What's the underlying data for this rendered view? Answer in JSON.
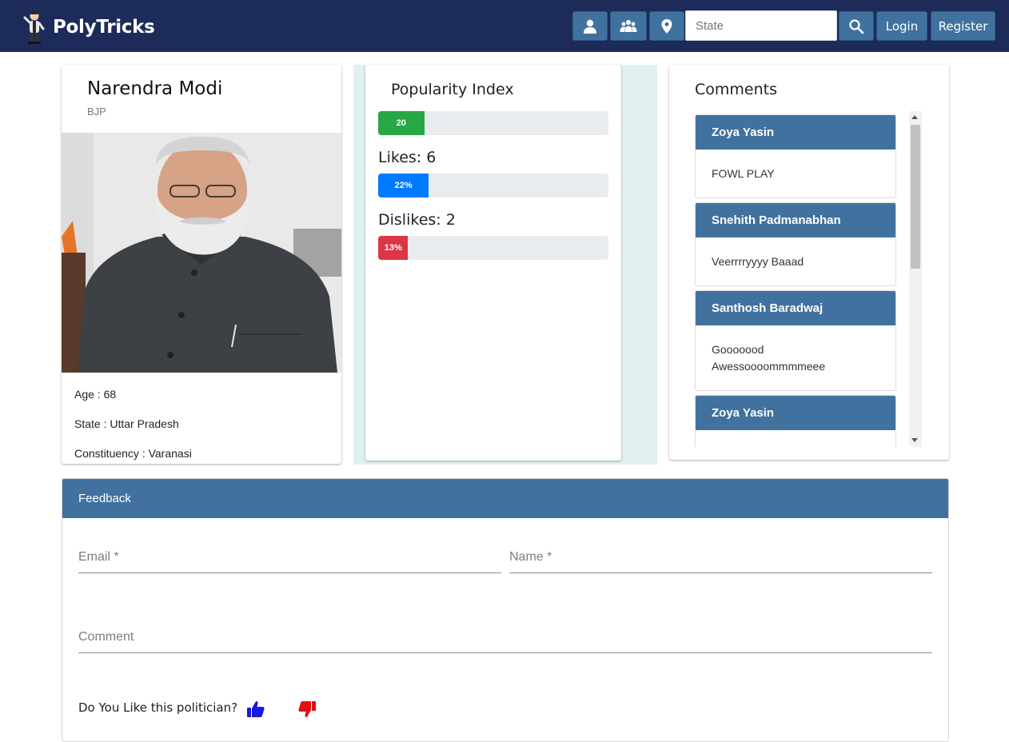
{
  "app": {
    "name": "PolyTricks"
  },
  "navbar": {
    "icons": [
      "person-icon",
      "group-icon",
      "location-pin-icon",
      "search-icon"
    ],
    "search": {
      "placeholder": "State",
      "value": ""
    },
    "login_label": "Login",
    "register_label": "Register"
  },
  "profile": {
    "name": "Narendra Modi",
    "party": "BJP",
    "age": "Age : 68",
    "state": "State : Uttar Pradesh",
    "constituency": "Constituency : Varanasi"
  },
  "popularity": {
    "title": "Popularity Index",
    "index_label": "20",
    "index_value": 20,
    "likes_label": "Likes: 6",
    "likes_percent_label": "22%",
    "likes_percent": 22,
    "dislikes_label": "Dislikes: 2",
    "dislikes_percent_label": "13%",
    "dislikes_percent": 13,
    "colors": {
      "index": "#28a745",
      "likes": "#007bff",
      "dislikes": "#dc3545"
    }
  },
  "comments": {
    "title": "Comments",
    "items": [
      {
        "author": "Zoya Yasin",
        "text": "FOWL PLAY"
      },
      {
        "author": "Snehith Padmanabhan",
        "text": "Veerrrryyyy Baaad"
      },
      {
        "author": "Santhosh Baradwaj",
        "text": "Gooooood Awessoooommmmeee"
      },
      {
        "author": "Zoya Yasin",
        "text": ""
      }
    ]
  },
  "feedback": {
    "title": "Feedback",
    "email_placeholder": "Email *",
    "name_placeholder": "Name *",
    "comment_placeholder": "Comment",
    "like_question": "Do You Like this politician?"
  },
  "colors": {
    "navbar": "#1c2b5a",
    "accent": "#41729f",
    "teal_panel": "#e1f1f1",
    "like": "#1a1adb",
    "dislike": "#e01010"
  }
}
